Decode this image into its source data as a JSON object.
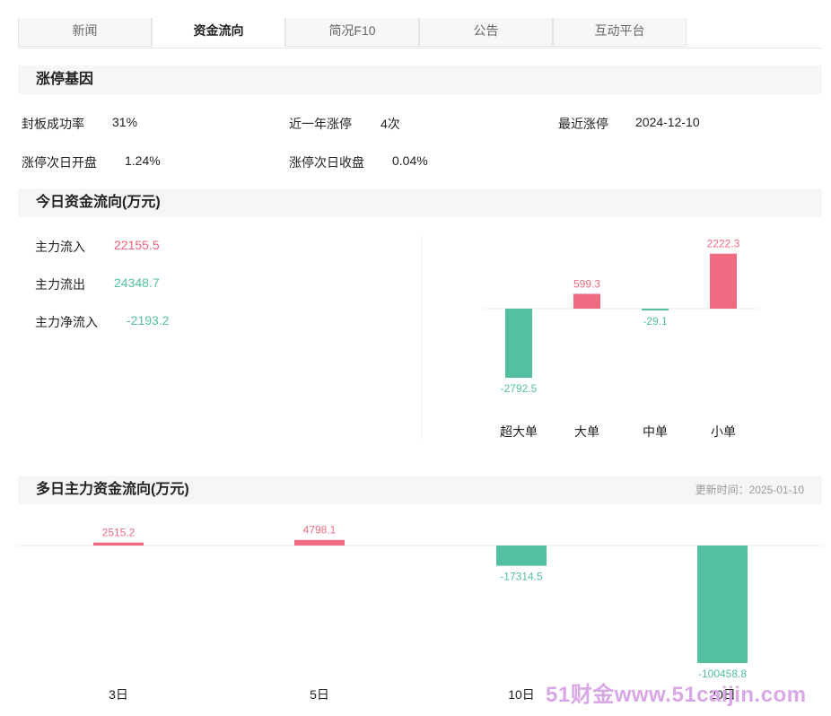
{
  "tabs": [
    {
      "label": "新闻",
      "active": false
    },
    {
      "label": "资金流向",
      "active": true
    },
    {
      "label": "简况F10",
      "active": false
    },
    {
      "label": "公告",
      "active": false
    },
    {
      "label": "互动平台",
      "active": false
    }
  ],
  "limit_up": {
    "title": "涨停基因",
    "items": [
      {
        "label": "封板成功率",
        "value": "31%"
      },
      {
        "label": "近一年涨停",
        "value": "4次"
      },
      {
        "label": "最近涨停",
        "value": "2024-12-10"
      },
      {
        "label": "涨停次日开盘",
        "value": "1.24%"
      },
      {
        "label": "涨停次日收盘",
        "value": "0.04%"
      }
    ]
  },
  "today_flow": {
    "title": "今日资金流向(万元)",
    "inflow_label": "主力流入",
    "inflow_value": "22155.5",
    "outflow_label": "主力流出",
    "outflow_value": "24348.7",
    "net_label": "主力净流入",
    "net_value": "-2193.2"
  },
  "multi_day": {
    "title": "多日主力资金流向(万元)",
    "update_time": "更新时间：2025-01-10"
  },
  "colors": {
    "positive": "#f06b82",
    "negative": "#53c0a1",
    "accent": "#333333"
  },
  "watermark": "51财金www.51caijin.com",
  "chart_data": [
    {
      "type": "bar",
      "categories": [
        "超大单",
        "大单",
        "中单",
        "小单"
      ],
      "values": [
        -2792.5,
        599.3,
        -29.1,
        2222.3
      ],
      "value_labels": [
        "-2792.5",
        "599.3",
        "-29.1",
        "2222.3"
      ],
      "title": "",
      "xlabel": "",
      "ylabel": ""
    },
    {
      "type": "bar",
      "categories": [
        "3日",
        "5日",
        "10日",
        "20日"
      ],
      "values": [
        2515.2,
        4798.1,
        -17314.5,
        -100458.8
      ],
      "value_labels": [
        "2515.2",
        "4798.1",
        "-17314.5",
        "-100458.8"
      ],
      "title": "",
      "xlabel": "",
      "ylabel": ""
    }
  ]
}
